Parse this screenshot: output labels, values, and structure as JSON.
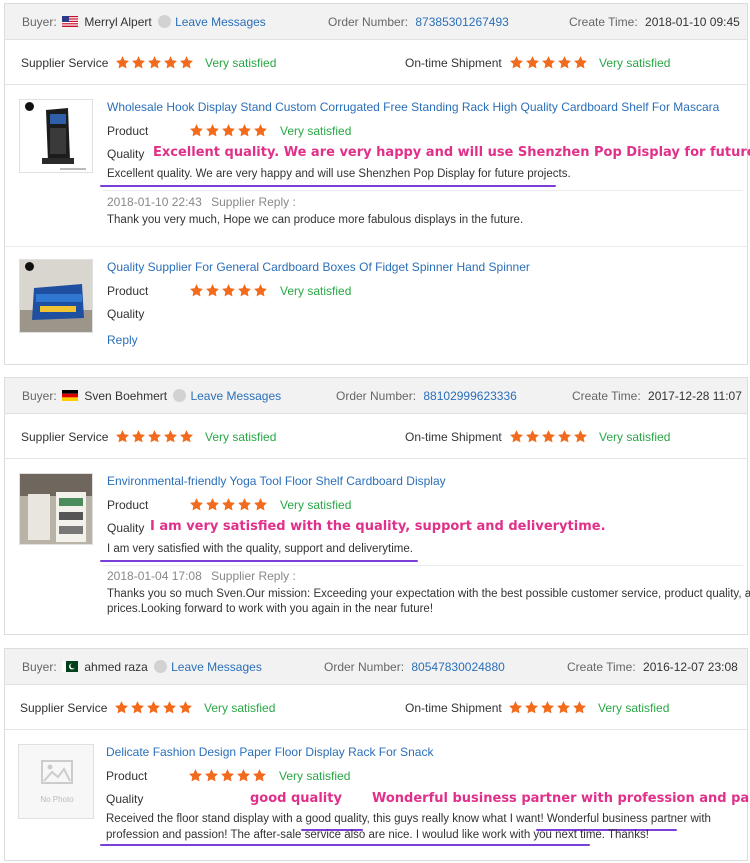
{
  "colors": {
    "accent": "#2a6fb9",
    "star": "#f26a1b",
    "satisfied": "#28a745",
    "annotation": "#e0308a",
    "underline": "#7a3fd6"
  },
  "labels": {
    "buyer": "Buyer:",
    "leave_messages": "Leave Messages",
    "order_number": "Order Number:",
    "create_time": "Create Time:",
    "supplier_service": "Supplier Service",
    "ontime_shipment": "On-time Shipment",
    "product": "Product",
    "quality": "Quality",
    "supplier_reply": "Supplier Reply :",
    "reply_link": "Reply",
    "no_photo": "No Photo"
  },
  "reviews": [
    {
      "buyer": "Merryl Alpert",
      "flag": "us-flag",
      "order_number": "87385301267493",
      "create_time": "2018-01-10 09:45",
      "supplier_rating": 5,
      "supplier_service": "Very satisfied",
      "ontime_rating": 5,
      "ontime_shipment": "Very satisfied",
      "items": [
        {
          "title": "Wholesale Hook Display Stand Custom Corrugated Free Standing Rack High Quality Cardboard Shelf For Mascara",
          "product_rating": 5,
          "product_text": "Very satisfied",
          "annotation": "Excellent quality. We are very happy and will use Shenzhen Pop Display for future",
          "comment": "Excellent quality. We are very happy and will use Shenzhen Pop Display for future projects.",
          "reply_date": "2018-01-10 22:43",
          "reply_text": "Thank you very much, Hope we can produce more fabulous displays in the future."
        },
        {
          "title": "Quality Supplier For General Cardboard Boxes Of Fidget Spinner Hand Spinner",
          "product_rating": 5,
          "product_text": "Very satisfied"
        }
      ]
    },
    {
      "buyer": "Sven Boehmert",
      "flag": "de-flag",
      "order_number": "88102999623336",
      "create_time": "2017-12-28 11:07",
      "supplier_rating": 5,
      "supplier_service": "Very satisfied",
      "ontime_rating": 5,
      "ontime_shipment": "Very satisfied",
      "items": [
        {
          "title": "Environmental-friendly Yoga Tool Floor Shelf Cardboard Display",
          "product_rating": 5,
          "product_text": "Very satisfied",
          "annotation": "I am very satisfied with the quality, support and deliverytime.",
          "comment": "I am very satisfied with the quality, support and deliverytime.",
          "reply_date": "2018-01-04 17:08",
          "reply_text_1": "Thanks you so much Sven.Our mission: Exceeding your expectation with the best possible customer service, product quality, and",
          "reply_text_2": "prices.Looking forward to work with you again in the near future!"
        }
      ]
    },
    {
      "buyer": "ahmed raza",
      "flag": "pk-flag",
      "order_number": "80547830024880",
      "create_time": "2016-12-07 23:08",
      "supplier_rating": 5,
      "supplier_service": "Very satisfied",
      "ontime_rating": 5,
      "ontime_shipment": "Very satisfied",
      "items": [
        {
          "title": "Delicate Fashion Design Paper Floor Display Rack For Snack",
          "product_rating": 5,
          "product_text": "Very satisfied",
          "annotation_1": "good quality",
          "annotation_2": "Wonderful business partner with profession and passion",
          "comment_1": "Received the floor stand display with a good quality, this guys really know what I want! Wonderful business partner with",
          "comment_2": "profession and passion! The after-sale service also are nice. I woulud like work with you next time. Thanks!"
        }
      ]
    }
  ]
}
